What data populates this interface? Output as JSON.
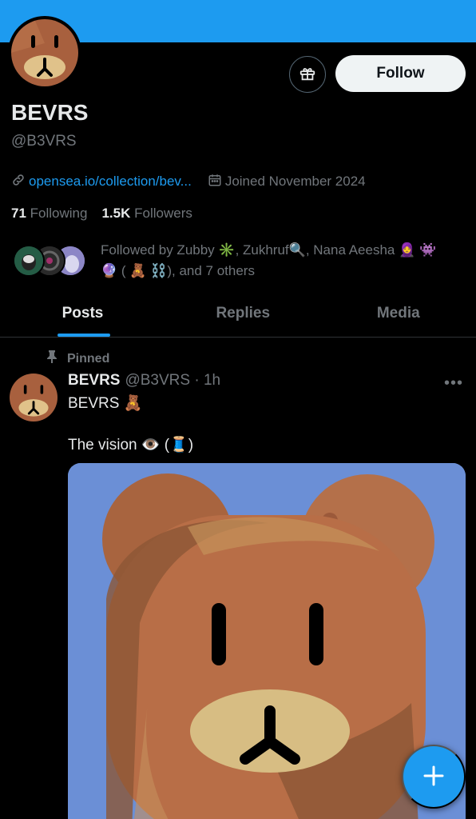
{
  "profile": {
    "display_name": "BEVRS",
    "handle": "@B3VRS",
    "link": "opensea.io/collection/bev...",
    "joined": "Joined November 2024",
    "following_count": "71",
    "following_label": "Following",
    "followers_count": "1.5K",
    "followers_label": "Followers",
    "followed_by": "Followed by Zubby ✳️, Zukhruf🔍, Nana Aeesha 🧕 👾 🔮 ( 🧸 ⛓️), and 7 others"
  },
  "actions": {
    "follow_label": "Follow",
    "gift_icon": "gift-icon",
    "compose_icon": "plus-icon"
  },
  "tabs": [
    {
      "label": "Posts",
      "active": true
    },
    {
      "label": "Replies",
      "active": false
    },
    {
      "label": "Media",
      "active": false
    }
  ],
  "post": {
    "pinned_label": "Pinned",
    "author_name": "BEVRS",
    "author_handle": "@B3VRS · 1h",
    "line1": "BEVRS 🧸",
    "line2": "The vision 👁️ (🧵)"
  },
  "colors": {
    "accent": "#1d9bf0",
    "bear_brown": "#a8603e",
    "bear_snout": "#e0c28a",
    "media_bg": "#6b8fd6"
  }
}
